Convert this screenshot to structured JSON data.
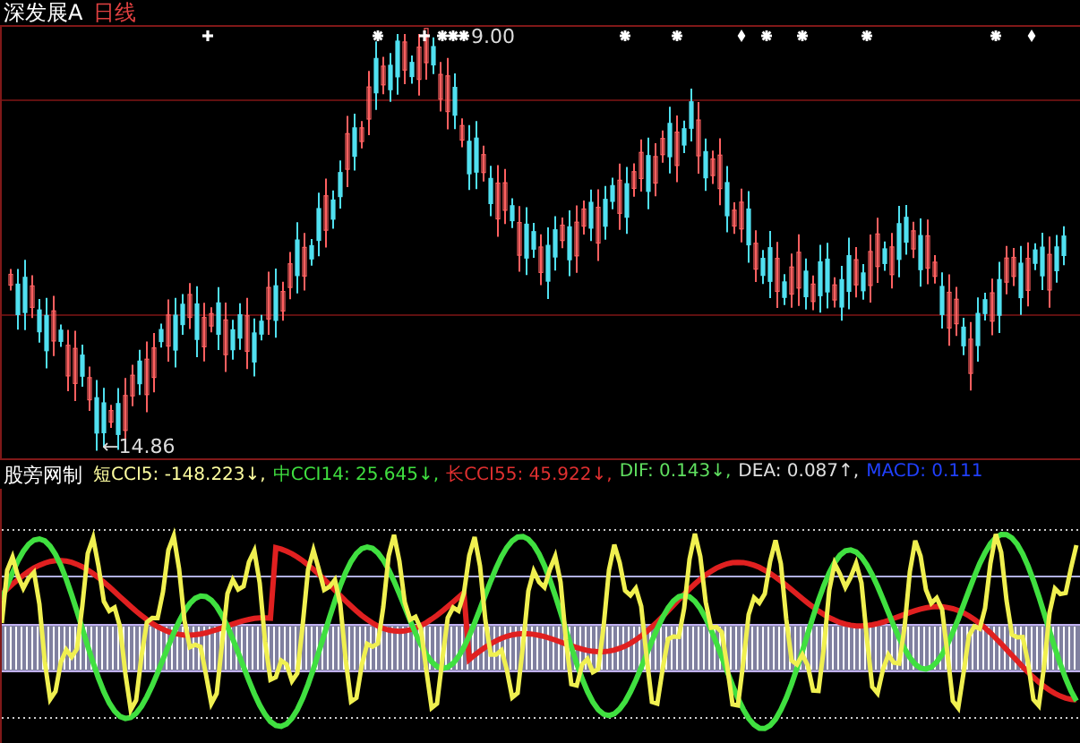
{
  "header": {
    "title": "深发展A",
    "period": "日线"
  },
  "price_chart": {
    "high_label": "9.00",
    "low_label": "←14.86",
    "signal_marks": [
      {
        "kind": "plus"
      },
      {
        "kind": "star"
      },
      {
        "kind": "plus"
      },
      {
        "kind": "star"
      },
      {
        "kind": "star"
      },
      {
        "kind": "star"
      },
      {
        "kind": "star"
      },
      {
        "kind": "star"
      },
      {
        "kind": "diamond"
      },
      {
        "kind": "star"
      },
      {
        "kind": "star"
      },
      {
        "kind": "star"
      },
      {
        "kind": "star"
      },
      {
        "kind": "diamond"
      }
    ]
  },
  "indicator": {
    "title": "股旁网制",
    "readings": [
      {
        "name": "短CCI5:",
        "value": "-148.223",
        "arrow": "↓",
        "separator": ",",
        "color": "#ffffa0"
      },
      {
        "name": "中CCI14:",
        "value": "25.645",
        "arrow": "↓",
        "separator": ",",
        "color": "#40e040"
      },
      {
        "name": "长CCI55:",
        "value": "45.922",
        "arrow": "↓",
        "separator": ",",
        "color": "#e03030"
      },
      {
        "name": "DIF:",
        "value": "0.143",
        "arrow": "↓",
        "separator": ",",
        "color": "#60e060"
      },
      {
        "name": "DEA:",
        "value": "0.087",
        "arrow": "↑",
        "separator": ",",
        "color": "#e0e0e0"
      },
      {
        "name": "MACD:",
        "value": "0.111",
        "color": "#2040ff"
      }
    ]
  }
}
